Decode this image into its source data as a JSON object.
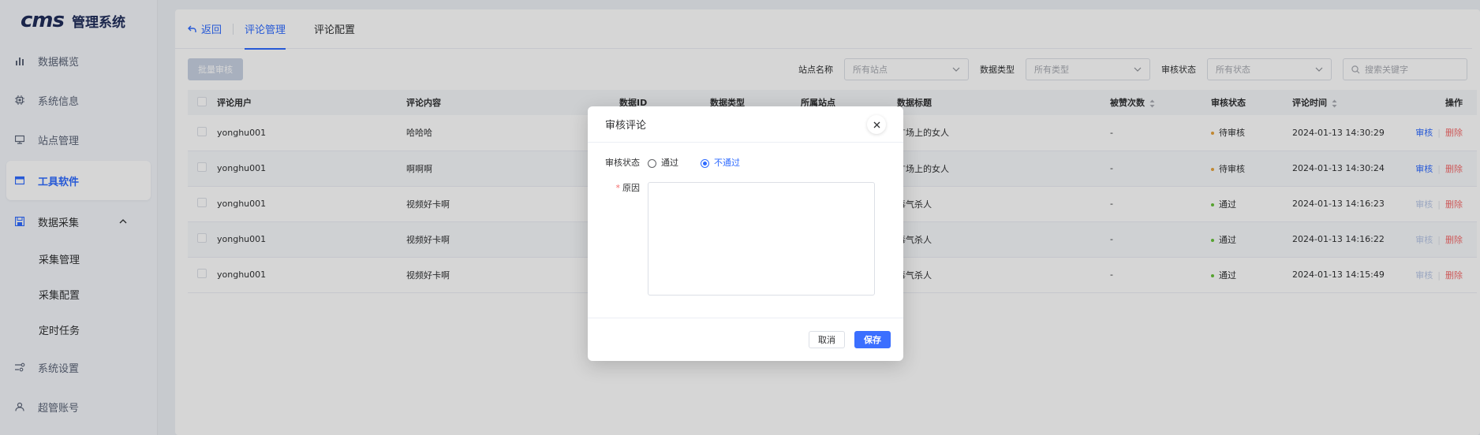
{
  "brand": {
    "logo_mark": "cms",
    "title": "管理系统"
  },
  "sidebar": {
    "items": [
      {
        "label": "数据概览",
        "icon": "bar-chart-icon"
      },
      {
        "label": "系统信息",
        "icon": "chip-icon"
      },
      {
        "label": "站点管理",
        "icon": "monitor-icon"
      },
      {
        "label": "工具软件",
        "icon": "window-icon",
        "active": true
      },
      {
        "label": "数据采集",
        "icon": "save-icon",
        "expanded": true
      },
      {
        "label": "系统设置",
        "icon": "settings-sliders-icon"
      },
      {
        "label": "超管账号",
        "icon": "user-icon"
      }
    ],
    "subitems": [
      {
        "label": "采集管理"
      },
      {
        "label": "采集配置"
      },
      {
        "label": "定时任务"
      }
    ]
  },
  "tabs": {
    "back_label": "返回",
    "items": [
      {
        "label": "评论管理",
        "active": true
      },
      {
        "label": "评论配置",
        "active": false
      }
    ]
  },
  "toolbar": {
    "batch_label": "批量审核",
    "filters": [
      {
        "label": "站点名称",
        "value": "所有站点"
      },
      {
        "label": "数据类型",
        "value": "所有类型"
      },
      {
        "label": "审核状态",
        "value": "所有状态"
      }
    ],
    "search_placeholder": "搜索关键字"
  },
  "table": {
    "columns": [
      "评论用户",
      "评论内容",
      "数据ID",
      "数据类型",
      "所属站点",
      "数据标题",
      "被赞次数",
      "审核状态",
      "评论时间",
      "操作"
    ],
    "rows": [
      {
        "user": "yonghu001",
        "content": "哈哈哈",
        "title": "广场上的女人",
        "likes": "-",
        "status": "待审核",
        "status_color": "#e6a23c",
        "time": "2024-01-13 14:30:29",
        "audit_enabled": true
      },
      {
        "user": "yonghu001",
        "content": "啊啊啊",
        "title": "广场上的女人",
        "likes": "-",
        "status": "待审核",
        "status_color": "#e6a23c",
        "time": "2024-01-13 14:30:24",
        "audit_enabled": true
      },
      {
        "user": "yonghu001",
        "content": "视频好卡啊",
        "title": "毒气杀人",
        "likes": "-",
        "status": "通过",
        "status_color": "#67c23a",
        "time": "2024-01-13 14:16:23",
        "audit_enabled": false
      },
      {
        "user": "yonghu001",
        "content": "视频好卡啊",
        "title": "毒气杀人",
        "likes": "-",
        "status": "通过",
        "status_color": "#67c23a",
        "time": "2024-01-13 14:16:22",
        "audit_enabled": false
      },
      {
        "user": "yonghu001",
        "content": "视频好卡啊",
        "title": "毒气杀人",
        "likes": "-",
        "status": "通过",
        "status_color": "#67c23a",
        "time": "2024-01-13 14:15:49",
        "audit_enabled": false
      }
    ],
    "op_audit": "审核",
    "op_delete": "删除"
  },
  "dialog": {
    "title": "审核评论",
    "status_label": "审核状态",
    "options": [
      {
        "label": "通过",
        "checked": false
      },
      {
        "label": "不通过",
        "checked": true
      }
    ],
    "reason_label": "原因",
    "reason_value": "",
    "cancel_label": "取消",
    "save_label": "保存"
  },
  "colors": {
    "accent": "#2f6bff",
    "danger": "#f56c6c",
    "pending": "#e6a23c",
    "passed": "#67c23a"
  }
}
